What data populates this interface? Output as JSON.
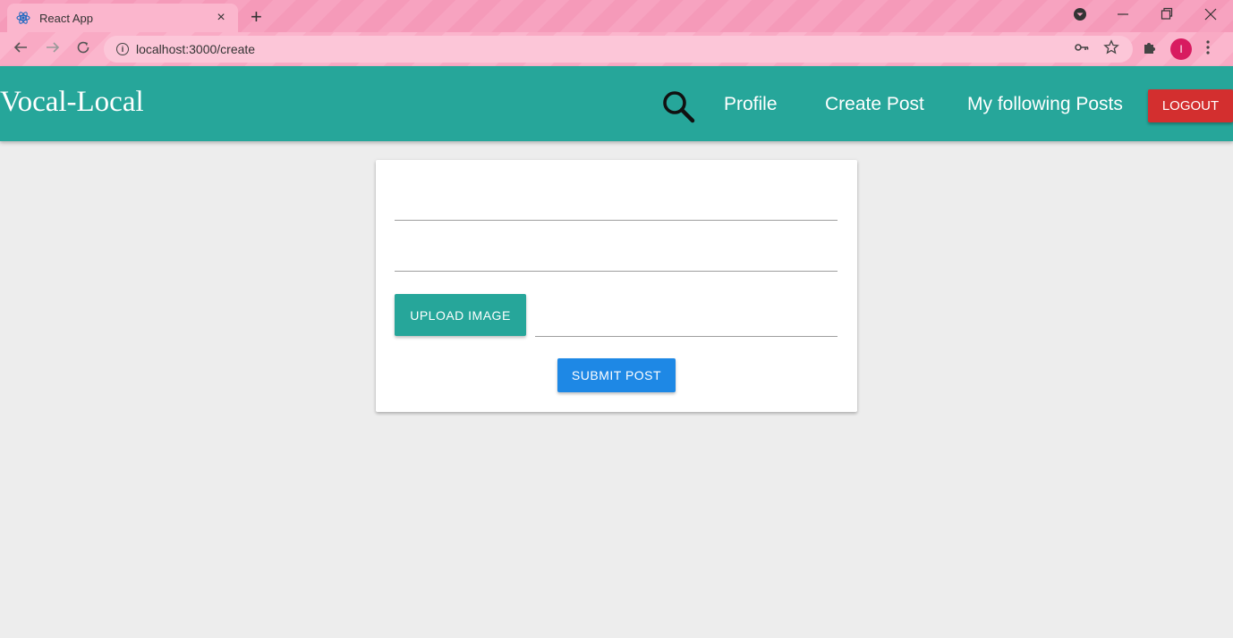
{
  "browser": {
    "tab_title": "React App",
    "tab_close": "×",
    "new_tab": "+",
    "url": "localhost:3000/create",
    "profile_initial": "I"
  },
  "navbar": {
    "brand": "Vocal-Local",
    "links": [
      "Profile",
      "Create Post",
      "My following Posts"
    ],
    "logout_label": "LOGOUT"
  },
  "form": {
    "title_value": "",
    "body_value": "",
    "upload_label": "UPLOAD IMAGE",
    "file_path_value": "",
    "submit_label": "SUBMIT POST"
  },
  "colors": {
    "navbar": "#26a69a",
    "logout": "#d32f2f",
    "submit": "#1e88e5",
    "upload": "#26a69a"
  }
}
